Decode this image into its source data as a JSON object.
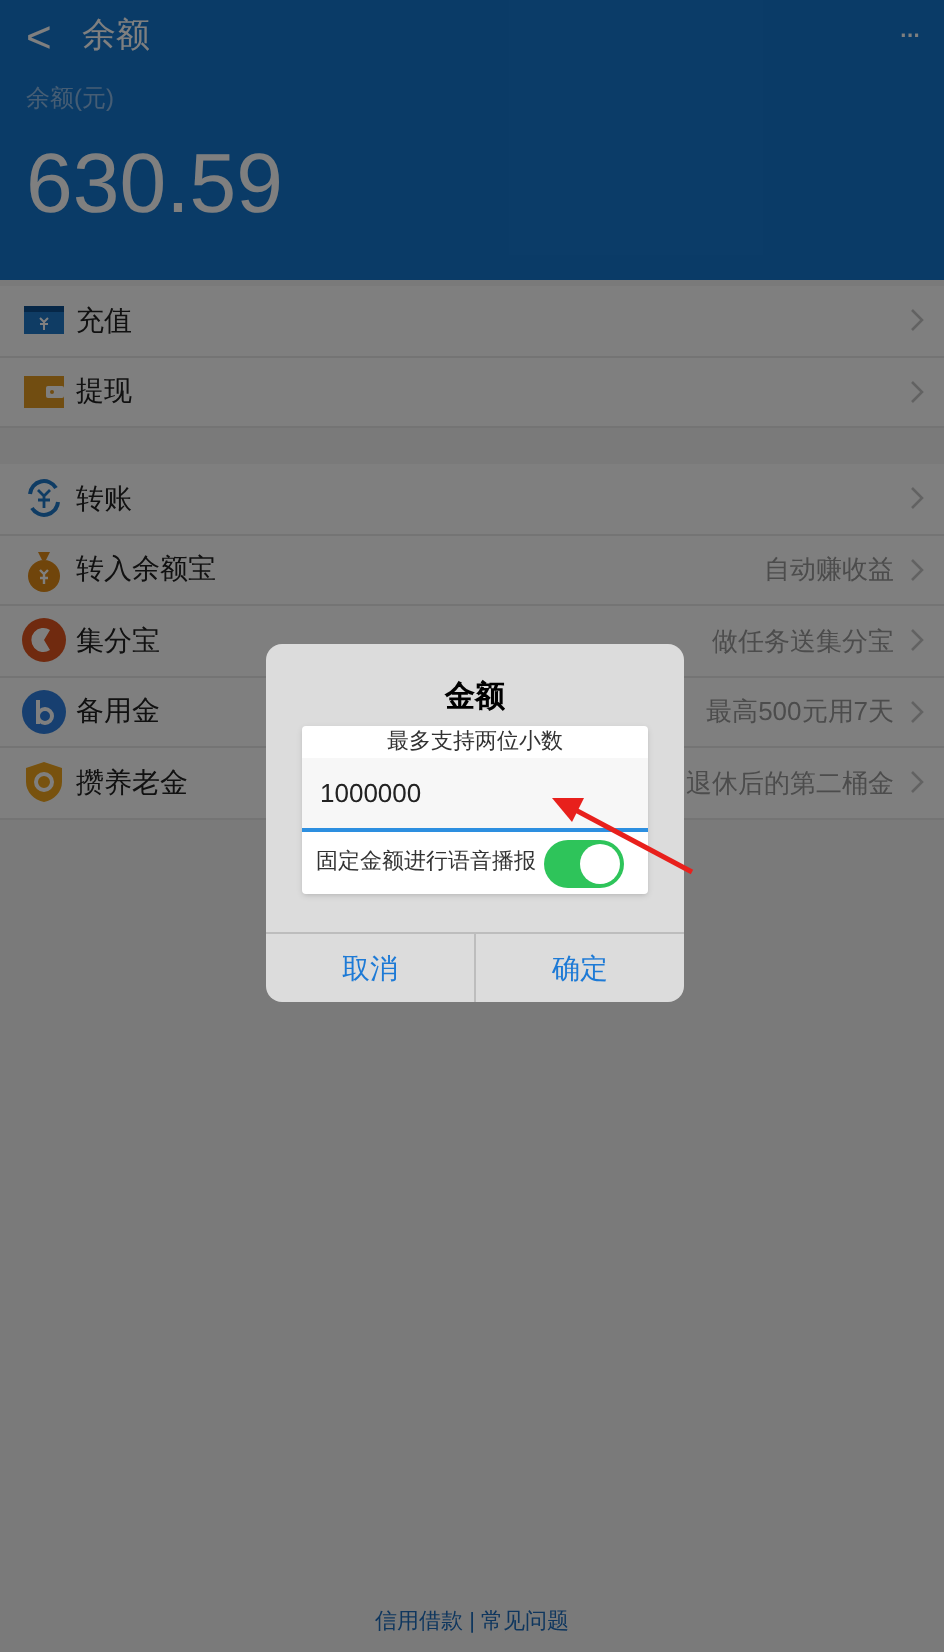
{
  "header": {
    "back": "<",
    "title": "余额",
    "more": "···",
    "balance_label": "余额(元)",
    "balance": "630.59"
  },
  "sections": [
    [
      {
        "label": "充值"
      },
      {
        "label": "提现"
      }
    ],
    [
      {
        "label": "转账"
      },
      {
        "label": "转入余额宝",
        "note": "自动赚收益"
      },
      {
        "label": "集分宝",
        "note": "做任务送集分宝"
      },
      {
        "label": "备用金",
        "note": "最高500元用7天"
      },
      {
        "label": "攒养老金",
        "note": "退休后的第二桶金"
      }
    ]
  ],
  "footer": {
    "links": [
      "信用借款",
      "常见问题"
    ],
    "separator": "|"
  },
  "dialog": {
    "title": "金额",
    "hint": "最多支持两位小数",
    "value": "1000000",
    "toggle_label": "固定金额进行语音播报",
    "toggle_on": true,
    "buttons": [
      "取消",
      "确定"
    ]
  }
}
